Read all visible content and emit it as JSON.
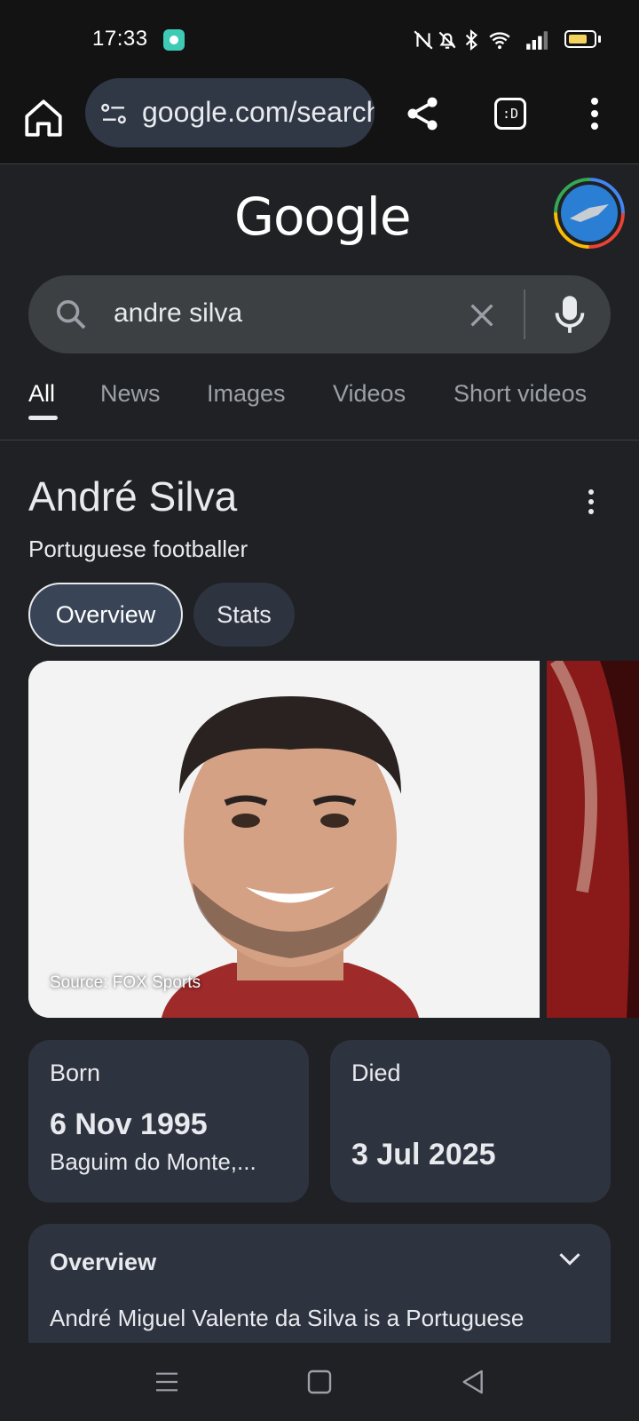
{
  "status_bar": {
    "time": "17:33",
    "icons": [
      "nfc-off-icon",
      "bell-off-icon",
      "bluetooth-icon",
      "wifi-icon",
      "signal-icon",
      "battery-icon"
    ],
    "battery_level": 0.75
  },
  "browser": {
    "url": "google.com/search",
    "tab_count_label": ":D",
    "icons": [
      "home-icon",
      "site-settings-icon",
      "share-icon",
      "tabs-icon",
      "more-vert-icon"
    ]
  },
  "google": {
    "logo": "Google",
    "query": "andre silva",
    "tabs": [
      {
        "label": "All",
        "selected": true
      },
      {
        "label": "News"
      },
      {
        "label": "Images"
      },
      {
        "label": "Videos"
      },
      {
        "label": "Short videos"
      }
    ]
  },
  "knowledge_panel": {
    "title": "André Silva",
    "subtitle": "Portuguese footballer",
    "chips": [
      "Overview",
      "Stats"
    ],
    "photo_caption": "Source: FOX Sports",
    "born": {
      "label": "Born",
      "value": "6 Nov 1995",
      "place": "Baguim do Monte,..."
    },
    "died": {
      "label": "Died",
      "value": "3 Jul 2025"
    },
    "overview": {
      "title": "Overview",
      "text": "André Miguel Valente da Silva is a Portuguese professional footballer who plays..."
    }
  },
  "colors": {
    "background": "#202124",
    "toolbar": "#131314",
    "chip_selected": "#394457",
    "card": "#2e3340"
  }
}
